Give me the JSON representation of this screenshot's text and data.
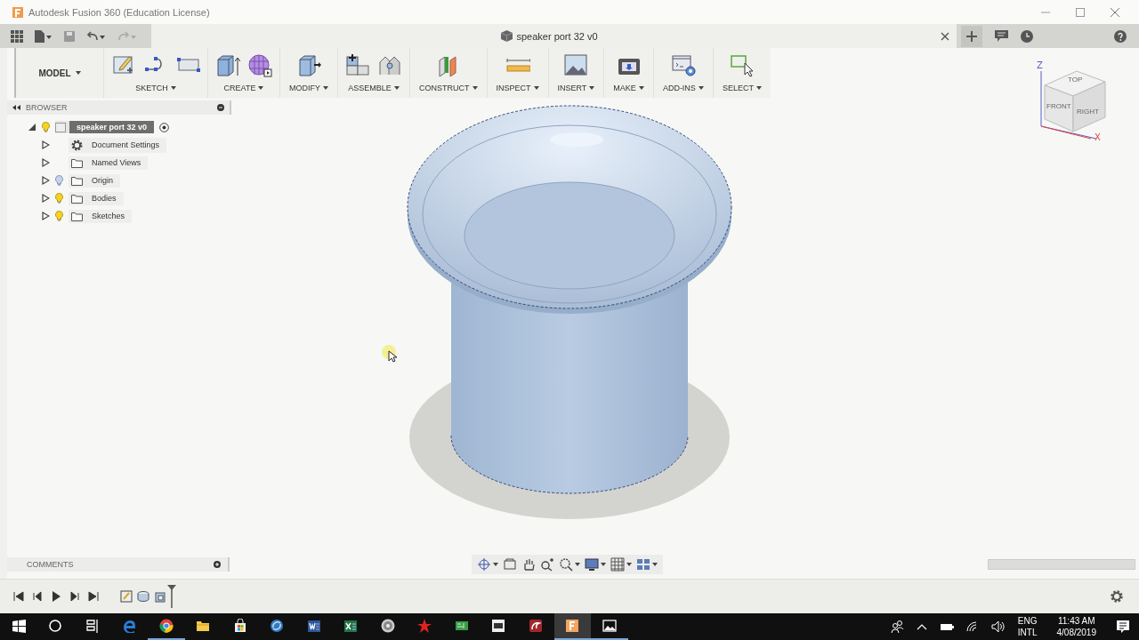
{
  "window": {
    "title": "Autodesk Fusion 360 (Education License)"
  },
  "document_tab": {
    "title": "speaker port 32 v0"
  },
  "toolbar": {
    "workspace": "MODEL",
    "groups": [
      {
        "label": "SKETCH",
        "tools": [
          {
            "kind": "sketch"
          },
          {
            "kind": "spline"
          },
          {
            "kind": "rect"
          }
        ]
      },
      {
        "label": "CREATE",
        "tools": [
          {
            "kind": "extrude"
          },
          {
            "kind": "form"
          }
        ]
      },
      {
        "label": "MODIFY",
        "tools": [
          {
            "kind": "pushpull"
          }
        ]
      },
      {
        "label": "ASSEMBLE",
        "tools": [
          {
            "kind": "component"
          },
          {
            "kind": "joint"
          }
        ]
      },
      {
        "label": "CONSTRUCT",
        "tools": [
          {
            "kind": "plane"
          }
        ]
      },
      {
        "label": "INSPECT",
        "tools": [
          {
            "kind": "measure"
          }
        ]
      },
      {
        "label": "INSERT",
        "tools": [
          {
            "kind": "image"
          }
        ]
      },
      {
        "label": "MAKE",
        "tools": [
          {
            "kind": "print"
          }
        ]
      },
      {
        "label": "ADD-INS",
        "tools": [
          {
            "kind": "script"
          }
        ]
      },
      {
        "label": "SELECT",
        "tools": [
          {
            "kind": "select"
          }
        ]
      }
    ]
  },
  "browser": {
    "title": "BROWSER",
    "root": {
      "label": "speaker port 32 v0",
      "expanded": true,
      "visible": true,
      "selected": true,
      "children": [
        {
          "label": "Document Settings",
          "kind": "settings",
          "expanded": false,
          "selected": false
        },
        {
          "label": "Named Views",
          "kind": "folder",
          "expanded": false,
          "selected": false
        },
        {
          "label": "Origin",
          "kind": "folder",
          "expanded": false,
          "visible": false,
          "selected": false
        },
        {
          "label": "Bodies",
          "kind": "folder",
          "expanded": false,
          "visible": true,
          "selected": false
        },
        {
          "label": "Sketches",
          "kind": "folder",
          "expanded": false,
          "visible": true,
          "selected": false
        }
      ]
    }
  },
  "viewcube": {
    "faces": [
      "TOP",
      "FRONT",
      "RIGHT"
    ],
    "axes": [
      "Z",
      "X"
    ]
  },
  "comments": {
    "title": "COMMENTS"
  },
  "taskbar": {
    "apps": [
      {
        "kind": "start",
        "running": false,
        "selected": false
      },
      {
        "kind": "search",
        "running": false,
        "selected": false
      },
      {
        "kind": "taskview",
        "running": false,
        "selected": false
      },
      {
        "kind": "edge",
        "running": false,
        "selected": false
      },
      {
        "kind": "chrome",
        "running": true,
        "selected": false
      },
      {
        "kind": "explorer",
        "running": false,
        "selected": false
      },
      {
        "kind": "store",
        "running": false,
        "selected": false
      },
      {
        "kind": "sync",
        "running": false,
        "selected": false
      },
      {
        "kind": "word",
        "running": false,
        "selected": false
      },
      {
        "kind": "excel",
        "running": false,
        "selected": false
      },
      {
        "kind": "disc",
        "running": false,
        "selected": false
      },
      {
        "kind": "star",
        "running": false,
        "selected": false
      },
      {
        "kind": "board",
        "running": false,
        "selected": false
      },
      {
        "kind": "terminal",
        "running": false,
        "selected": false
      },
      {
        "kind": "dragon",
        "running": false,
        "selected": false
      },
      {
        "kind": "fusion",
        "running": true,
        "selected": true
      },
      {
        "kind": "photos",
        "running": true,
        "selected": false
      }
    ],
    "tray": {
      "language": "ENG",
      "layout": "INTL",
      "time": "11:43 AM",
      "date": "4/08/2019"
    }
  }
}
